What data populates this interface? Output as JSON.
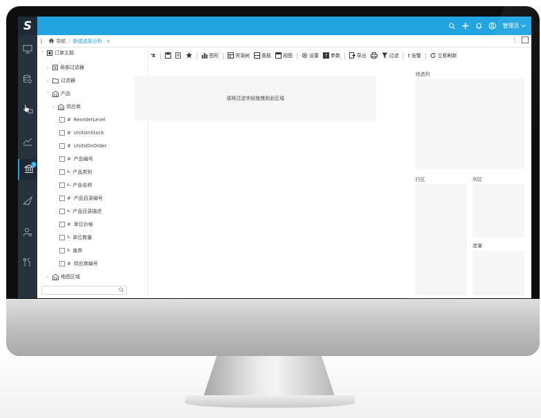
{
  "app": {
    "logo": "S",
    "admin_label": "管理员",
    "accent": "#21a4df",
    "rail_badge": "1"
  },
  "tabs": {
    "nav_label": "导航",
    "active_tab": "新建透视分析",
    "close_glyph": "×"
  },
  "tree": {
    "items": [
      {
        "label": "订单主题"
      },
      {
        "label": "局部过滤器"
      },
      {
        "label": "过滤器"
      },
      {
        "label": "产品"
      },
      {
        "label": "供应商"
      },
      {
        "label": "ReorderLevel"
      },
      {
        "label": "UnitsInStock"
      },
      {
        "label": "UnitsOnOrder"
      },
      {
        "label": "产品编号"
      },
      {
        "label": "产品类别"
      },
      {
        "label": "产品名称"
      },
      {
        "label": "产品目录编号"
      },
      {
        "label": "产品目录描述"
      },
      {
        "label": "单位价格"
      },
      {
        "label": "单位数量"
      },
      {
        "label": "废弃"
      },
      {
        "label": "供应商编号"
      },
      {
        "label": "地图区域"
      }
    ],
    "hash": "#",
    "az": "Aₐ",
    "search_placeholder": ""
  },
  "toolbar": {
    "chart": "图形",
    "resource_tree": "资源树",
    "panel": "面板",
    "view": "视图",
    "settings": "设置",
    "params": "参数",
    "export": "导出",
    "filter": "过滤",
    "alert": "告警",
    "refresh_now": "立即刷新"
  },
  "zones": {
    "filter_hint": "请将过滤字段拖拽到此区域",
    "candidates": "待选列",
    "rows": "行区",
    "cols": "列区",
    "measures": "度量"
  }
}
